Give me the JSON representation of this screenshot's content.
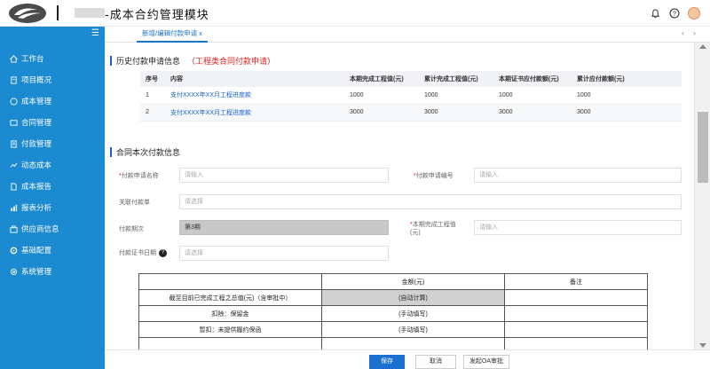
{
  "header": {
    "app_title": "-成本合约管理模块"
  },
  "sidebar": {
    "items": [
      {
        "label": "工作台",
        "icon": "home-icon"
      },
      {
        "label": "项目概况",
        "icon": "document-icon"
      },
      {
        "label": "成本管理",
        "icon": "coin-icon"
      },
      {
        "label": "合同管理",
        "icon": "contract-icon"
      },
      {
        "label": "付款管理",
        "icon": "payment-icon"
      },
      {
        "label": "动态成本",
        "icon": "dynamic-icon"
      },
      {
        "label": "成本报告",
        "icon": "report-icon"
      },
      {
        "label": "报表分析",
        "icon": "chart-icon"
      },
      {
        "label": "供应商信息",
        "icon": "supplier-icon"
      },
      {
        "label": "基础配置",
        "icon": "config-icon"
      },
      {
        "label": "系统管理",
        "icon": "settings-icon"
      }
    ]
  },
  "tabs": {
    "active_label": "新增/编辑付款申请 x"
  },
  "history": {
    "title": "历史付款申请信息",
    "subtitle": "（工程类合同付款申请）",
    "columns": [
      "序号",
      "内容",
      "本期完成工程值(元)",
      "累计完成工程值(元)",
      "本期证书应付款额(元)",
      "累计应付款额(元)"
    ],
    "rows": [
      [
        "1",
        "支付XXXX年XX月工程进度款",
        "1000",
        "1000",
        "1000",
        "1000"
      ],
      [
        "2",
        "支付XXXX年XX月工程进度款",
        "3000",
        "3000",
        "3000",
        "3000"
      ]
    ]
  },
  "form": {
    "title": "合同本次付款信息",
    "name_label": "付款申请名称",
    "name_placeholder": "请输入",
    "code_label": "付款申请编号",
    "code_placeholder": "请输入",
    "link_label": "关联付款单",
    "link_placeholder": "请选择",
    "period_label": "付款期次",
    "period_value": "第3期",
    "engineering_label_1": "本期完成工程值",
    "engineering_label_2": "(元)",
    "engineering_placeholder": "请输入",
    "date_label": "付款证书日期",
    "date_placeholder": "请选择"
  },
  "amounts": {
    "header_amount": "金额(元)",
    "header_note": "备注",
    "rows": [
      {
        "label": "截至目前已完成工程之总值(元)（含审批中）",
        "value": "(自动计算)"
      },
      {
        "label": "扣除：保留金",
        "value": "(手动填写)"
      },
      {
        "label": "暂扣：未提供履约保函",
        "value": "(手动填写)"
      }
    ]
  },
  "footer": {
    "save_label": "保存",
    "cancel_label": "取消",
    "oa_label": "发起OA审批"
  }
}
